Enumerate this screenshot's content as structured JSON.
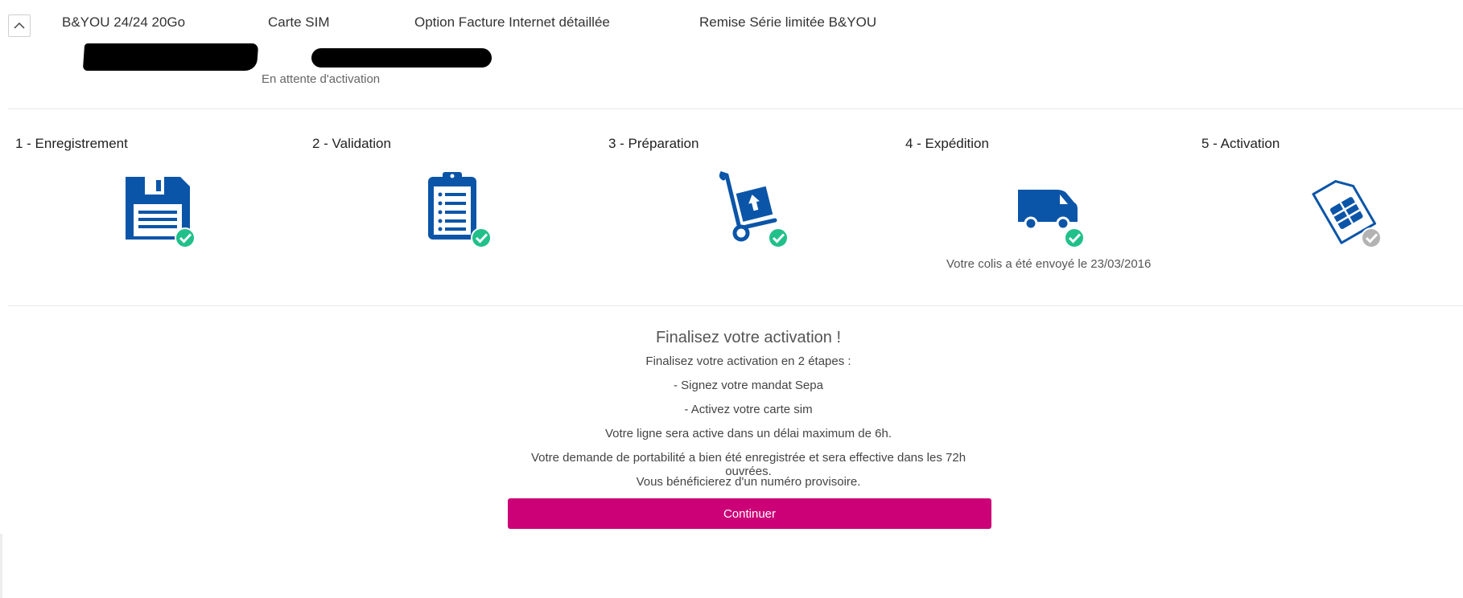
{
  "header": {
    "items": [
      "B&YOU 24/24 20Go",
      "Carte SIM",
      "Option Facture Internet détaillée",
      "Remise Série limitée B&YOU"
    ],
    "status": "En attente d'activation"
  },
  "steps": [
    {
      "label": "1 - Enregistrement",
      "icon": "floppy-disk-icon",
      "done": true
    },
    {
      "label": "2 - Validation",
      "icon": "clipboard-list-icon",
      "done": true
    },
    {
      "label": "3 - Préparation",
      "icon": "hand-truck-box-icon",
      "done": true
    },
    {
      "label": "4 - Expédition",
      "icon": "delivery-van-icon",
      "done": true
    },
    {
      "label": "5 - Activation",
      "icon": "sim-card-icon",
      "done": false
    }
  ],
  "shipping_note": "Votre colis a été envoyé le 23/03/2016",
  "finalize": {
    "title": "Finalisez votre activation !",
    "lines": [
      "Finalisez votre activation en 2 étapes :",
      "- Signez votre mandat Sepa",
      "- Activez votre carte sim",
      "Votre ligne sera active dans un délai maximum de 6h.",
      "Votre demande de portabilité a bien été enregistrée et sera effective dans les 72h ouvrées.",
      "Vous bénéficierez d'un numéro provisoire."
    ],
    "button": "Continuer"
  },
  "colors": {
    "icon_blue": "#0b55a8",
    "check_green": "#21c08b",
    "check_pending": "#b3b3b3",
    "cta": "#cc0077"
  }
}
